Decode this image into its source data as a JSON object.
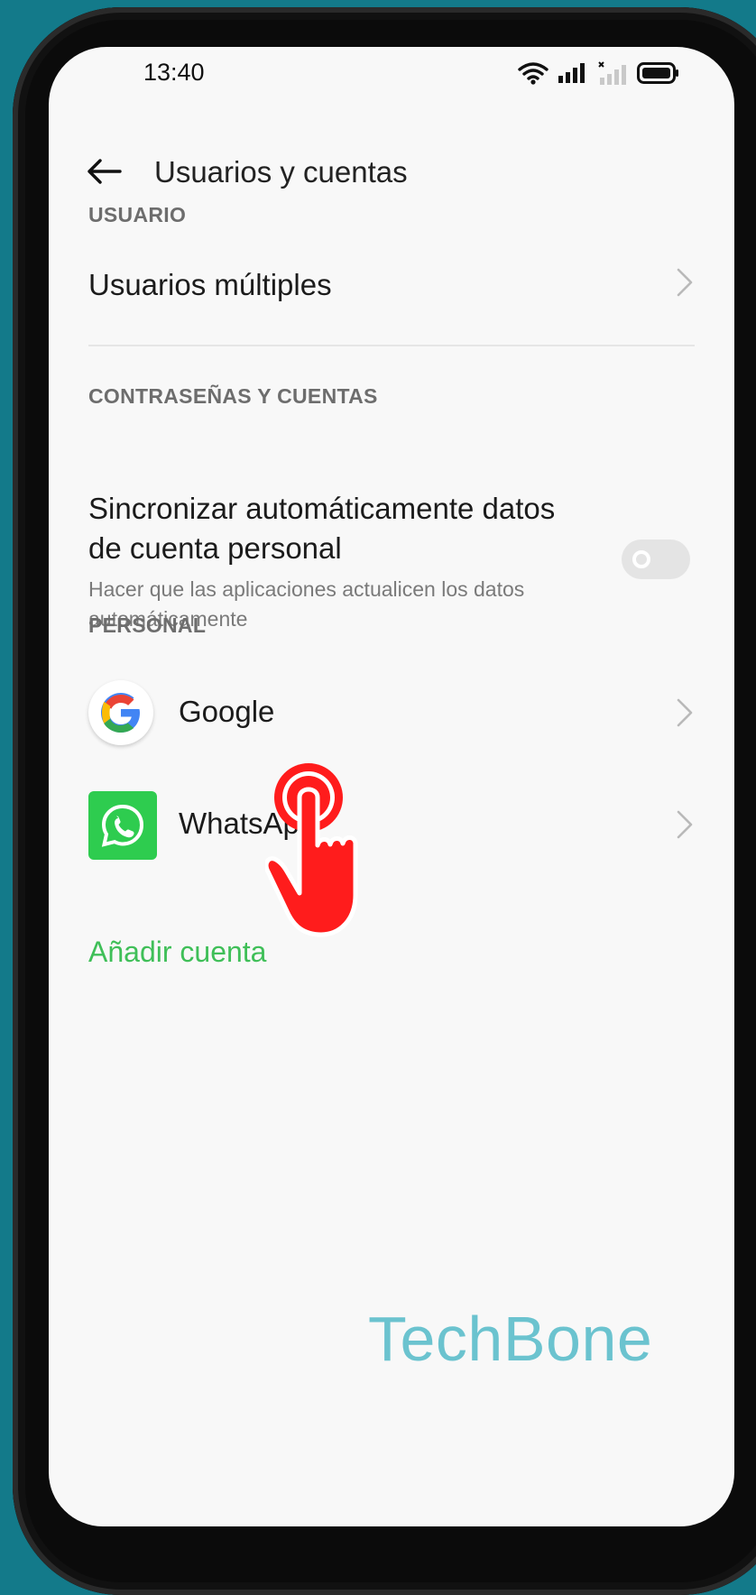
{
  "status_bar": {
    "time": "13:40"
  },
  "header": {
    "title": "Usuarios y cuentas"
  },
  "sections": {
    "user": {
      "label": "USUARIO",
      "items": [
        {
          "label": "Usuarios múltiples"
        }
      ]
    },
    "passwords": {
      "label": "CONTRASEÑAS Y CUENTAS",
      "sync": {
        "title": "Sincronizar automáticamente datos de cuenta personal",
        "description": "Hacer que las aplicaciones actualicen los datos automáticamente",
        "enabled": false
      }
    },
    "personal": {
      "label": "PERSONAL",
      "accounts": [
        {
          "label": "Google",
          "icon": "google-icon"
        },
        {
          "label": "WhatsApp",
          "icon": "whatsapp-icon"
        }
      ],
      "add_account": "Añadir cuenta"
    }
  },
  "watermark": "TechBone",
  "colors": {
    "accent_green": "#3fbf58",
    "whatsapp_green": "#2ecc4f",
    "tap_indicator_red": "#ff1c1c",
    "watermark": "#6bc3cf"
  }
}
